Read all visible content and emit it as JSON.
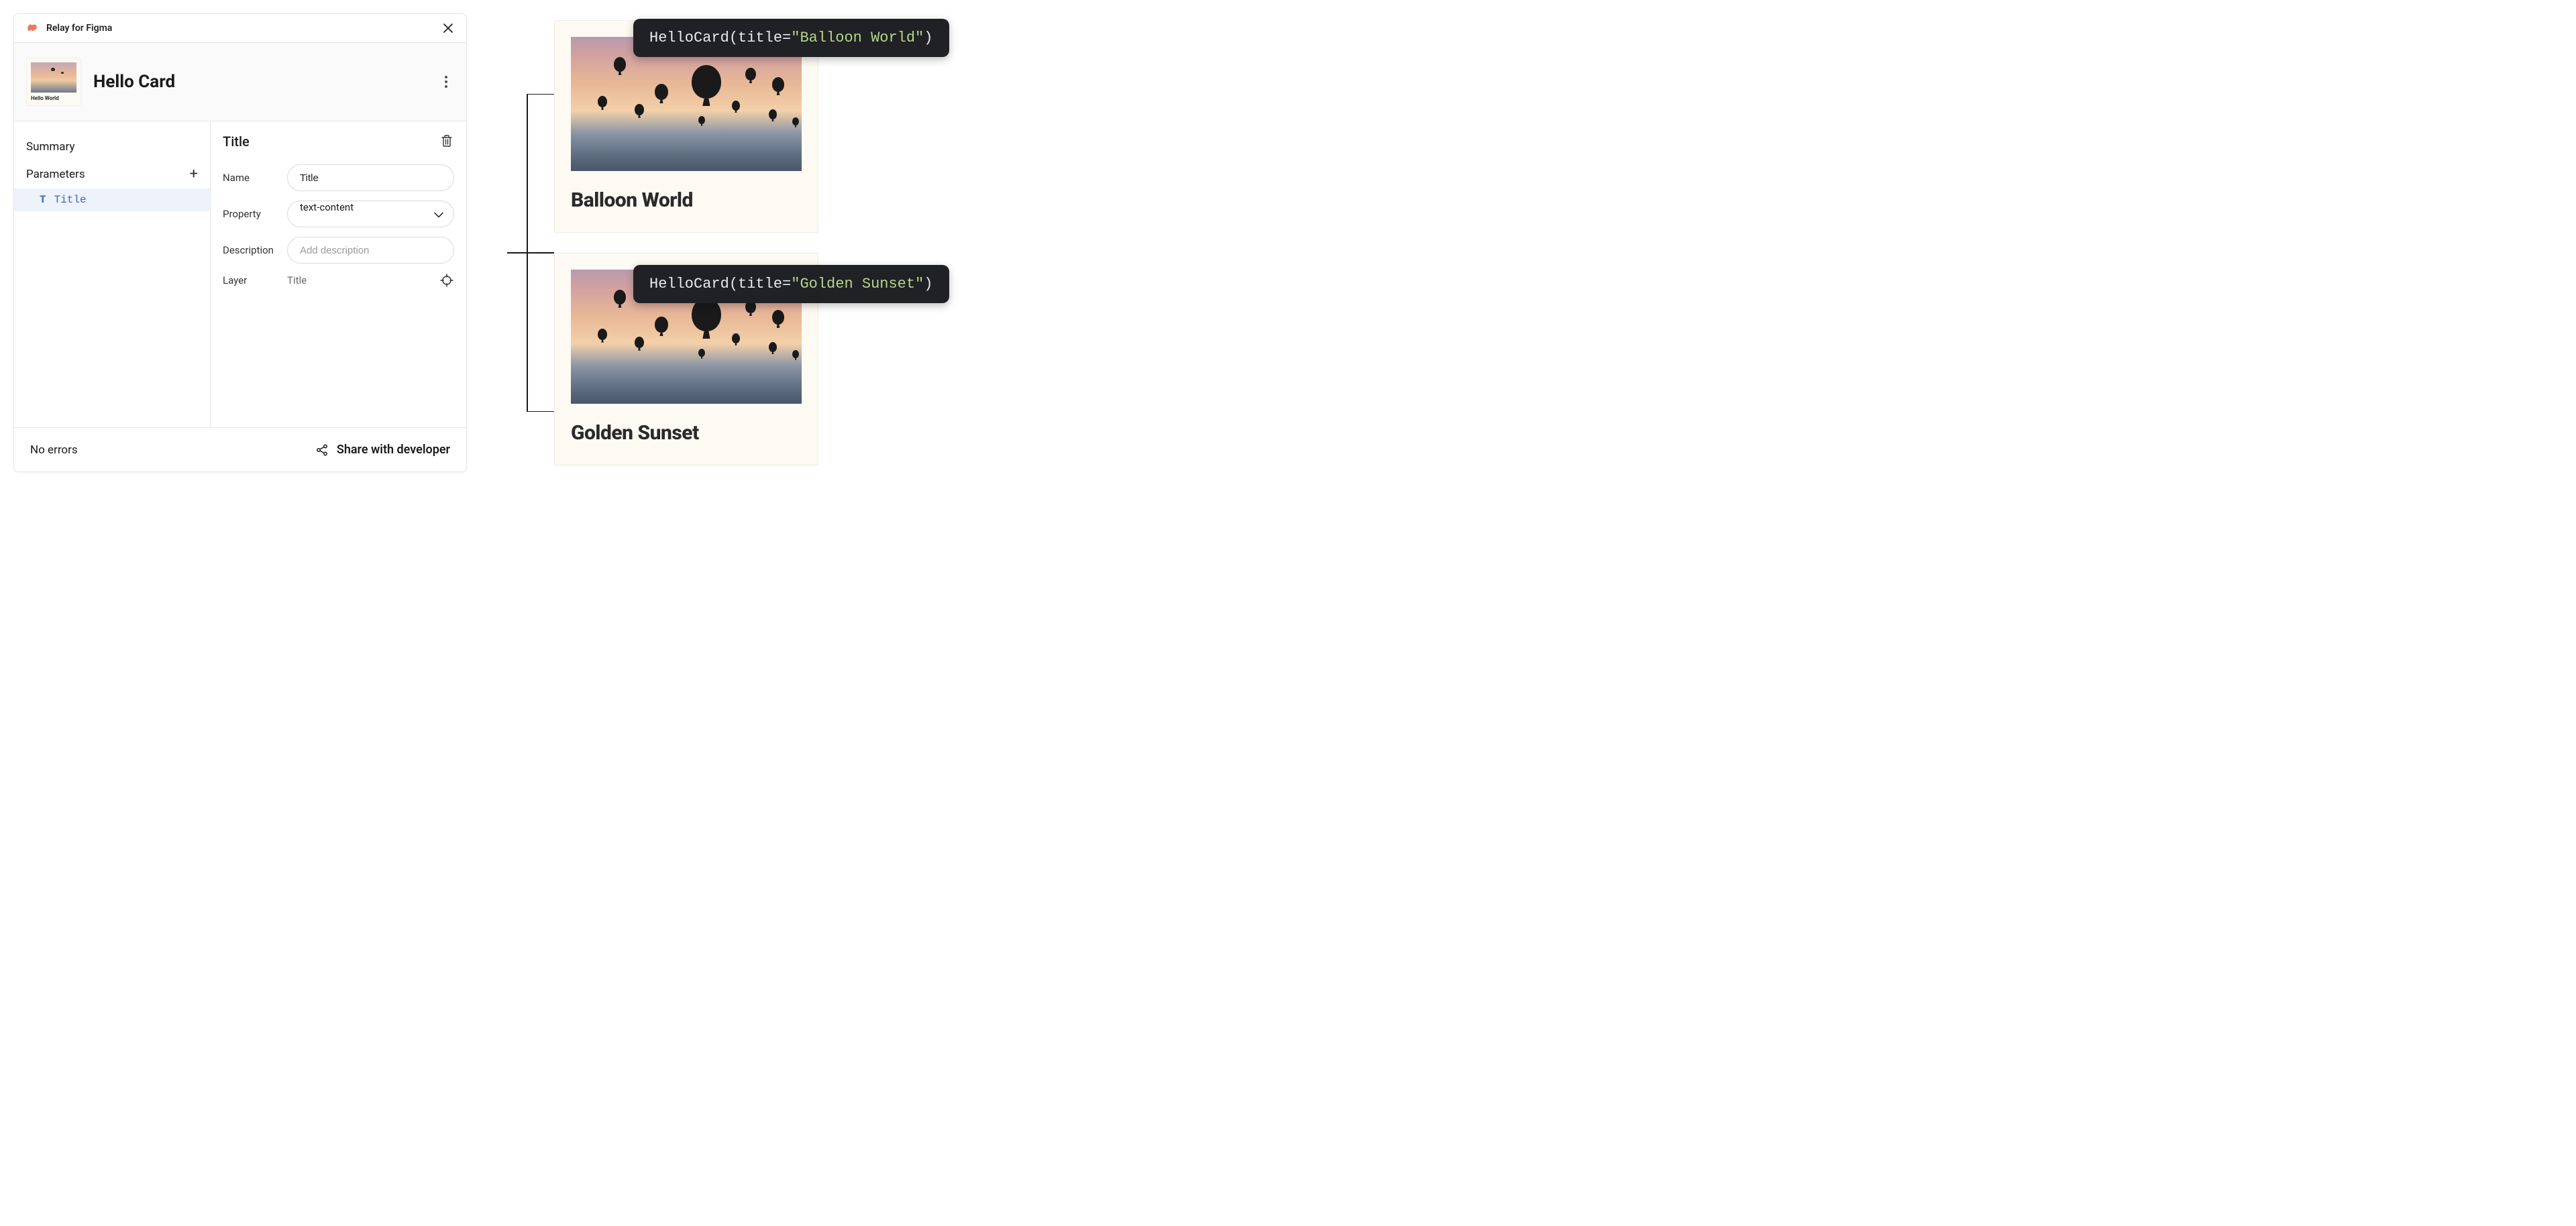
{
  "plugin": {
    "title": "Relay for Figma"
  },
  "component": {
    "name": "Hello Card",
    "thumb_label": "Hello World"
  },
  "sidebar": {
    "summary_label": "Summary",
    "parameters_label": "Parameters",
    "params": [
      {
        "icon": "T",
        "label": "Title"
      }
    ]
  },
  "detail": {
    "heading": "Title",
    "fields": {
      "name_label": "Name",
      "name_value": "Title",
      "property_label": "Property",
      "property_value": "text-content",
      "description_label": "Description",
      "description_placeholder": "Add description",
      "layer_label": "Layer",
      "layer_value": "Title"
    }
  },
  "footer": {
    "status": "No errors",
    "share_label": "Share with developer"
  },
  "code_chips": [
    {
      "fn": "HelloCard",
      "param": "title",
      "value": "\"Balloon World\""
    },
    {
      "fn": "HelloCard",
      "param": "title",
      "value": "\"Golden Sunset\""
    }
  ],
  "previews": [
    {
      "title": "Balloon World"
    },
    {
      "title": "Golden Sunset"
    }
  ]
}
